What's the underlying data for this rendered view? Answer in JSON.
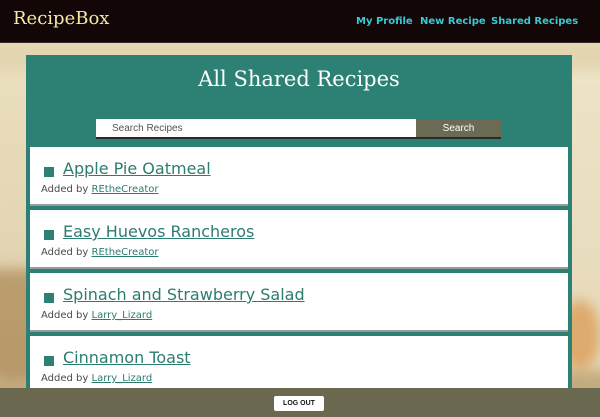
{
  "app": {
    "brand": "RecipeBox"
  },
  "nav": {
    "my_profile": "My Profile",
    "new_recipe": "New Recipe",
    "shared_recipes": "Shared Recipes"
  },
  "main": {
    "title": "All Shared Recipes",
    "search": {
      "placeholder": "Search Recipes",
      "value": "",
      "button_label": "Search"
    },
    "added_by_prefix": "Added by",
    "recipes": [
      {
        "title": "Apple Pie Oatmeal",
        "author": "REtheCreator"
      },
      {
        "title": "Easy Huevos Rancheros",
        "author": "REtheCreator"
      },
      {
        "title": "Spinach and Strawberry Salad",
        "author": "Larry_Lizard"
      },
      {
        "title": "Cinnamon Toast",
        "author": "Larry_Lizard"
      }
    ]
  },
  "footer": {
    "logout_label": "LOG OUT"
  },
  "colors": {
    "navbar_bg": "#120606",
    "brand": "#f5e9a8",
    "nav_link": "#38c9d6",
    "panel_bg": "#2c8074",
    "search_button_bg": "#6a6a55",
    "footer_bg": "#6a6950"
  },
  "icons": {
    "recipe_bullet": "square-bullet-icon"
  }
}
